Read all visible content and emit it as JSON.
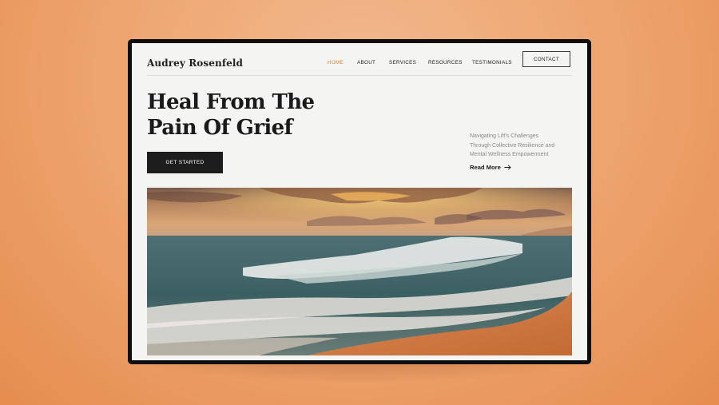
{
  "site": {
    "logo": "Audrey Rosenfeld"
  },
  "nav": {
    "items": [
      {
        "label": "HOME",
        "active": true
      },
      {
        "label": "ABOUT",
        "active": false
      },
      {
        "label": "SERVICES",
        "active": false
      },
      {
        "label": "RESOURCES",
        "active": false
      },
      {
        "label": "TESTIMONIALS",
        "active": false
      }
    ],
    "contact_label": "CONTACT"
  },
  "hero": {
    "title_line1": "Heal From The",
    "title_line2": "Pain Of Grief",
    "cta_label": "GET STARTED",
    "tagline_lines": [
      "Navigating Lift's Challenges",
      "Through Collective Resilience and",
      "Mental Wellness Empowerment"
    ],
    "read_more_label": "Read More"
  },
  "colors": {
    "accent": "#e1833f",
    "background": "#eea772",
    "dark": "#1d1d1d"
  },
  "icons": {
    "read_more": "arrow-right-icon"
  }
}
